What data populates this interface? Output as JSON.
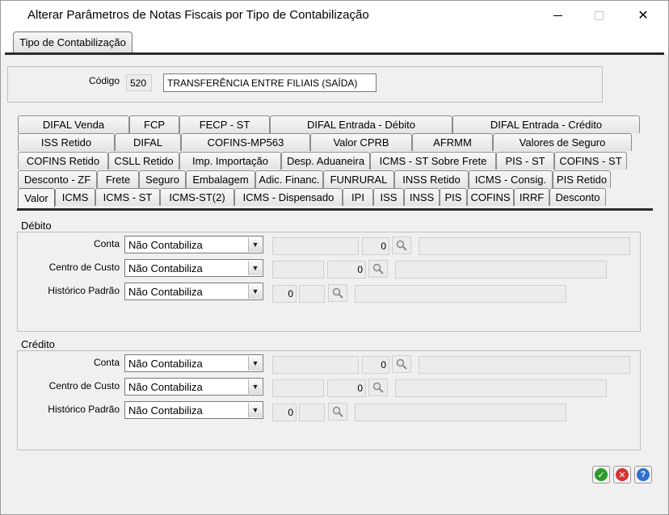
{
  "window": {
    "title": "Alterar Parâmetros de Notas Fiscais por Tipo de Contabilização",
    "minimize_icon": "minimize-icon",
    "maximize_icon": "maximize-icon",
    "close_icon": "close-icon",
    "close_glyph": "✕"
  },
  "top_tab": {
    "label": "Tipo de Contabilização"
  },
  "codigo": {
    "label": "Código",
    "value": "520",
    "description": "TRANSFERÊNCIA ENTRE FILIAIS (SAÍDA)"
  },
  "tab_rows": [
    [
      "DIFAL Venda",
      "FCP",
      "FECP - ST",
      "DIFAL Entrada - Débito",
      "DIFAL Entrada - Crédito"
    ],
    [
      "ISS Retido",
      "DIFAL",
      "COFINS-MP563",
      "Valor CPRB",
      "AFRMM",
      "Valores de Seguro"
    ],
    [
      "COFINS Retido",
      "CSLL Retido",
      "Imp. Importação",
      "Desp. Aduaneira",
      "ICMS - ST Sobre Frete",
      "PIS - ST",
      "COFINS - ST"
    ],
    [
      "Desconto - ZF",
      "Frete",
      "Seguro",
      "Embalagem",
      "Adic. Financ.",
      "FUNRURAL",
      "INSS Retido",
      "ICMS - Consig.",
      "PIS Retido"
    ],
    [
      "Valor",
      "ICMS",
      "ICMS - ST",
      "ICMS-ST(2)",
      "ICMS - Dispensado",
      "IPI",
      "ISS",
      "INSS",
      "PIS",
      "COFINS",
      "IRRF",
      "Desconto"
    ]
  ],
  "active_tab": "Valor",
  "debito": {
    "title": "Débito",
    "conta": {
      "label": "Conta",
      "value": "Não Contabiliza",
      "number": "0"
    },
    "centro": {
      "label": "Centro de Custo",
      "value": "Não Contabiliza",
      "number": "0"
    },
    "historico": {
      "label": "Histórico Padrão",
      "value": "Não Contabiliza",
      "number": "0"
    }
  },
  "credito": {
    "title": "Crédito",
    "conta": {
      "label": "Conta",
      "value": "Não Contabiliza",
      "number": "0"
    },
    "centro": {
      "label": "Centro de Custo",
      "value": "Não Contabiliza",
      "number": "0"
    },
    "historico": {
      "label": "Histórico Padrão",
      "value": "Não Contabiliza",
      "number": "0"
    }
  },
  "buttons": {
    "ok_icon": "check-icon",
    "ok_glyph": "✓",
    "cancel_icon": "cancel-icon",
    "cancel_glyph": "✕",
    "help_icon": "help-icon",
    "help_glyph": "?"
  },
  "colors": {
    "ok": "#2e9a2e",
    "cancel": "#d63232",
    "help": "#2f6fd0"
  }
}
